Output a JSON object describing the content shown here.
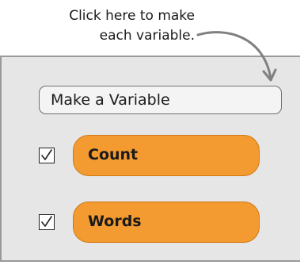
{
  "callout": {
    "line1": "Click here to make",
    "line2": "each variable."
  },
  "palette": {
    "make_variable_label": "Make a Variable",
    "variables": [
      {
        "name": "Count",
        "checked": true
      },
      {
        "name": "Words",
        "checked": true
      }
    ]
  },
  "colors": {
    "panel_bg": "#e6e6e6",
    "variable_block": "#f39a30",
    "arrow": "#808080"
  },
  "icons": {
    "checkbox_check": "checkmark-icon",
    "callout_arrow": "curved-arrow-icon"
  }
}
